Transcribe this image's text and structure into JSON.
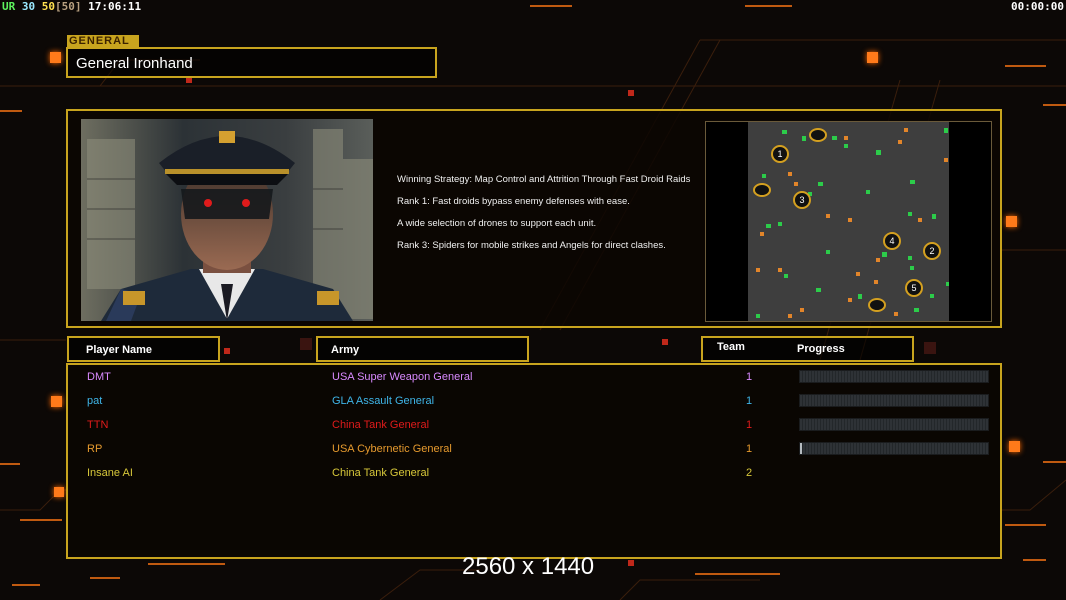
{
  "hud": {
    "ur_label": "UR",
    "n1": "30",
    "n2": "50",
    "n3": "[50]",
    "clock": "17:06:11",
    "timer": "00:00:00"
  },
  "general": {
    "tag": "GENERAL",
    "name": "General Ironhand"
  },
  "strategy": {
    "lines": [
      "Winning Strategy: Map Control and Attrition Through Fast Droid Raids",
      "Rank 1: Fast droids bypass enemy defenses with ease.",
      "A wide selection of drones to support each unit.",
      "Rank 3: Spiders for mobile strikes and Angels for direct clashes."
    ]
  },
  "map": {
    "start_labels": [
      "1",
      "2",
      "3",
      "4",
      "5"
    ]
  },
  "columns": {
    "player": "Player Name",
    "army": "Army",
    "team": "Team",
    "progress": "Progress"
  },
  "players": [
    {
      "name": "DMT",
      "army": "USA Super Weapon General",
      "team": "1",
      "progress": 0,
      "color": "#d98aff"
    },
    {
      "name": "pat",
      "army": "GLA Assault General",
      "team": "1",
      "progress": 0,
      "color": "#3fb5e8"
    },
    {
      "name": "TTN",
      "army": "China Tank General",
      "team": "1",
      "progress": 0,
      "color": "#e01b1b"
    },
    {
      "name": "RP",
      "army": "USA Cybernetic General",
      "team": "1",
      "progress": 0.01,
      "color": "#e69a2e"
    },
    {
      "name": "Insane AI",
      "army": "China Tank General",
      "team": "2",
      "progress": null,
      "color": "#d8c83a"
    }
  ],
  "resolution": "2560 x 1440",
  "colors": {
    "accent_gold": "#c8a41e",
    "accent_orange": "#ff7a1a"
  }
}
